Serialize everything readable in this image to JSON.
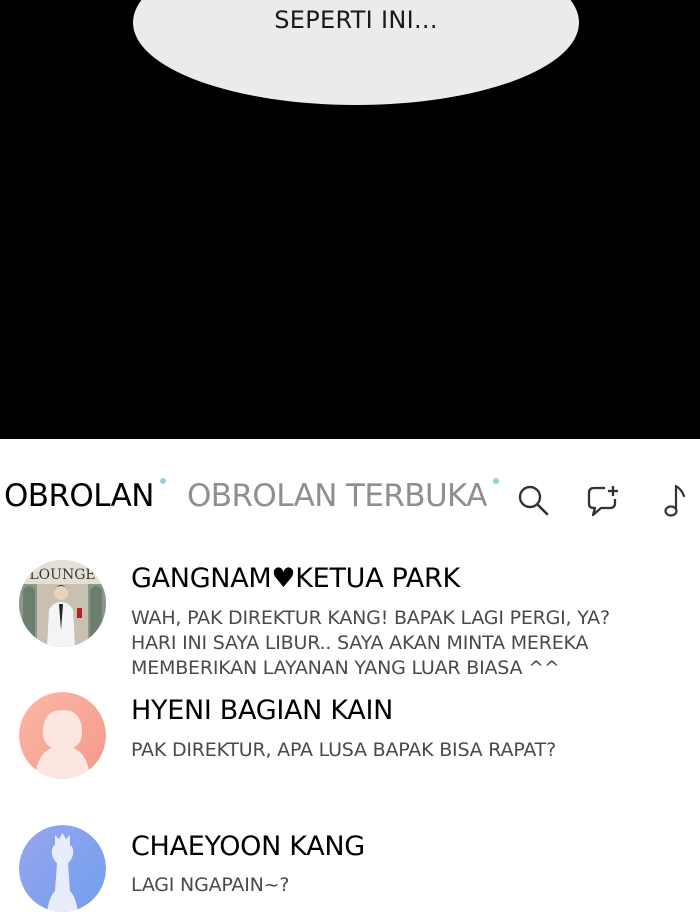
{
  "speech_bubble": {
    "text": "SEPERTI INI..."
  },
  "tabs": [
    {
      "label": "OBROLAN"
    },
    {
      "label": "OBROLAN TERBUKA"
    }
  ],
  "toolbar_icons": [
    "search-icon",
    "new-chat-icon",
    "music-icon"
  ],
  "chats": [
    {
      "name": "GANGNAM♥KETUA PARK",
      "avatar": "lounge-photo",
      "avatar_text": "LOUNGE",
      "message_lines": [
        "WAH, PAK DIREKTUR KANG! BAPAK LAGI PERGI, YA?",
        "HARI INI SAYA LIBUR.. SAYA AKAN MINTA MEREKA",
        "MEMBERIKAN LAYANAN YANG LUAR BIASA ^^"
      ]
    },
    {
      "name": "HYENI BAGIAN KAIN",
      "avatar": "default-profile-pink",
      "message_lines": [
        "PAK DIREKTUR, APA LUSA BAPAK BISA RAPAT?"
      ]
    },
    {
      "name": "CHAEYOON KANG",
      "avatar": "default-profile-blue",
      "message_lines": [
        "LAGI NGAPAIN~?"
      ]
    }
  ],
  "colors": {
    "accent_dot": "#8fd3e0",
    "tab_inactive": "#8f8f8f",
    "avatar_pink": "#f7a99a",
    "avatar_blue": "#7fa2f0"
  }
}
